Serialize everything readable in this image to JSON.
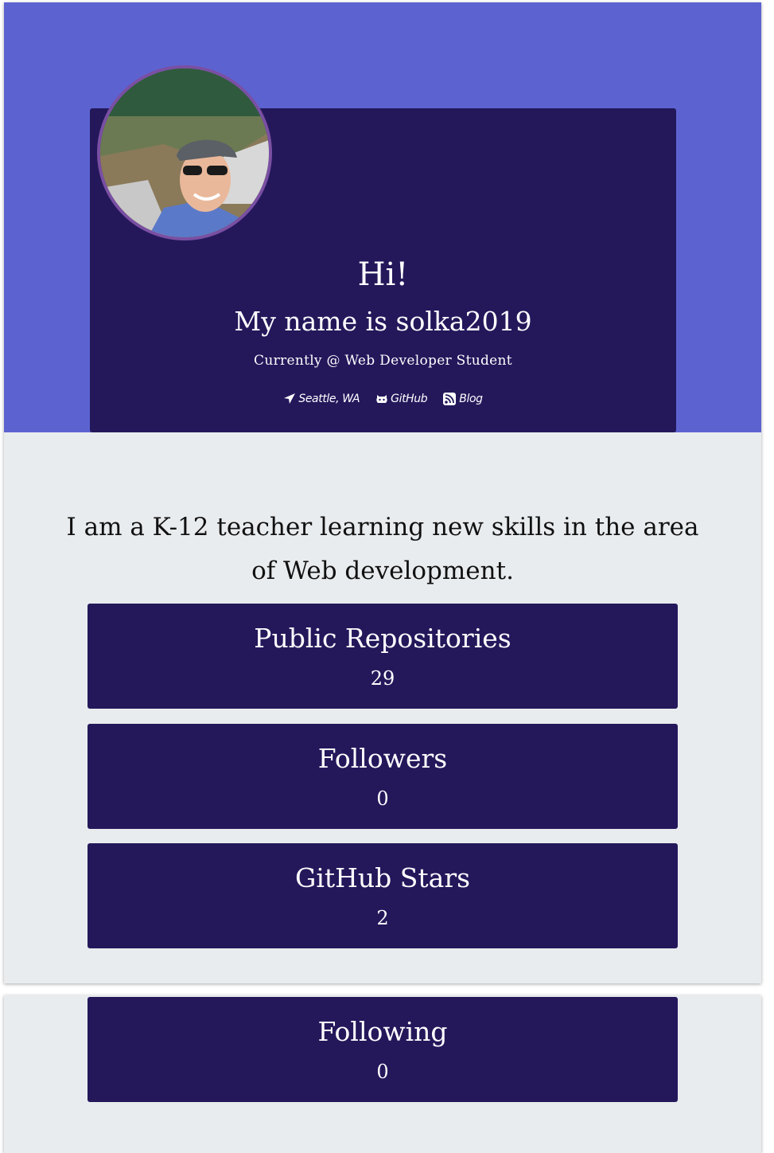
{
  "profile": {
    "greeting": "Hi!",
    "name_line": "My name is solka2019",
    "current": "Currently @ Web Developer Student",
    "avatar_alt": "Profile photo",
    "links": {
      "location": "Seattle, WA",
      "github": "GitHub",
      "blog": "Blog"
    }
  },
  "bio": "I am a K-12 teacher learning new skills in the area of Web development.",
  "stats": [
    {
      "label": "Public Repositories",
      "value": "29"
    },
    {
      "label": "Followers",
      "value": "0"
    },
    {
      "label": "GitHub Stars",
      "value": "2"
    },
    {
      "label": "Following",
      "value": "0"
    }
  ],
  "icons": {
    "location": "location-arrow-icon",
    "github": "github-octocat-icon",
    "blog": "rss-icon"
  },
  "colors": {
    "hero_background": "#5c63d1",
    "card_background": "#24185b",
    "page_background": "#e9ecee",
    "avatar_border": "#7a4fa3",
    "text_light": "#ffffff",
    "text_dark": "#111111"
  }
}
